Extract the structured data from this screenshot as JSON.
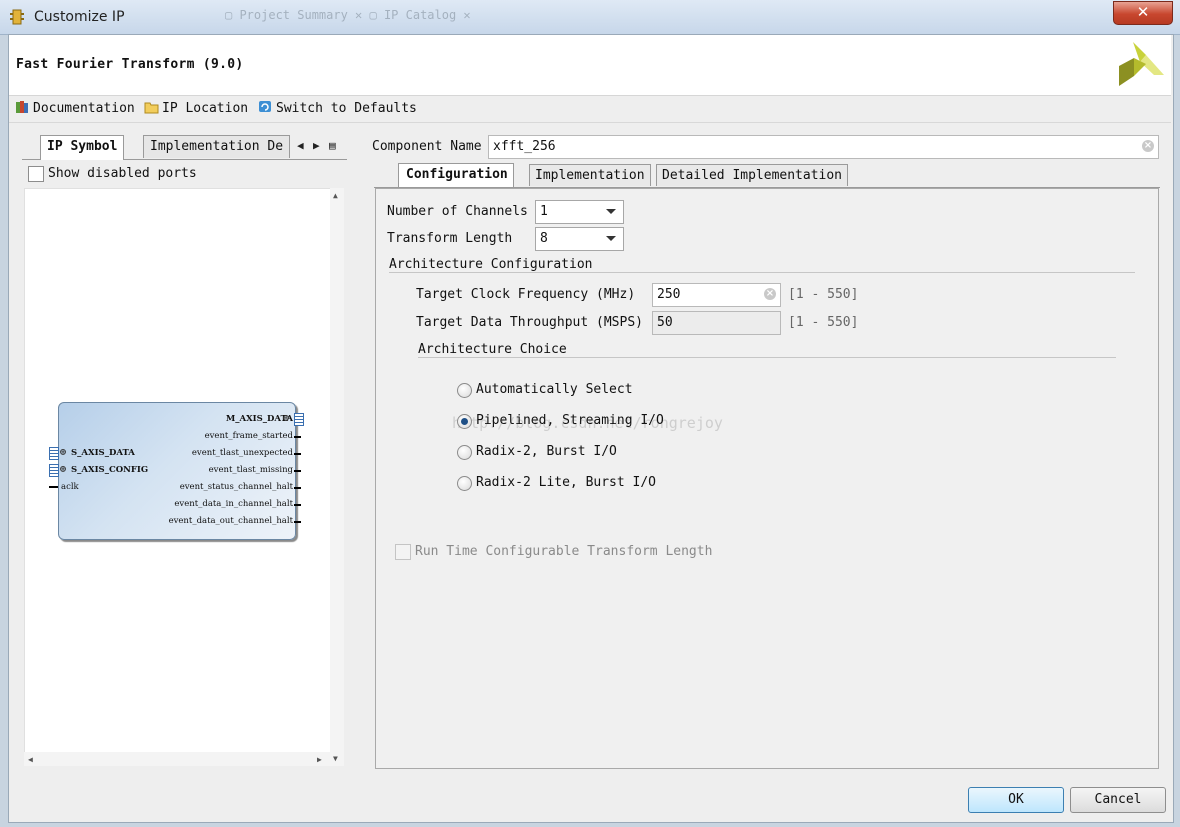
{
  "window": {
    "title": "Customize IP",
    "close_glyph": "✕",
    "background_tabs": "▢  Project Summary  ✕  ▢ IP Catalog  ✕"
  },
  "header": {
    "ip_title": "Fast Fourier Transform (9.0)",
    "logo": "xilinx-logo-icon"
  },
  "toolbar": {
    "documentation": "Documentation",
    "ip_location": "IP Location",
    "switch_defaults": "Switch to Defaults"
  },
  "left_panel": {
    "tabs": [
      "IP Symbol",
      "Implementation De"
    ],
    "show_disabled_ports": "Show disabled ports",
    "symbol": {
      "right_ports": [
        "M_AXIS_DATA",
        "event_frame_started",
        "event_tlast_unexpected",
        "event_tlast_missing",
        "event_status_channel_halt",
        "event_data_in_channel_halt",
        "event_data_out_channel_halt"
      ],
      "left_ports": [
        "S_AXIS_DATA",
        "S_AXIS_CONFIG",
        "aclk"
      ]
    }
  },
  "right_panel": {
    "component_name_label": "Component Name",
    "component_name_value": "xfft_256",
    "tabs": [
      "Configuration",
      "Implementation",
      "Detailed Implementation"
    ],
    "config": {
      "channels_label": "Number of Channels",
      "channels_value": "1",
      "length_label": "Transform Length",
      "length_value": "8",
      "arch_config_label": "Architecture Configuration",
      "clock_label": "Target Clock Frequency (MHz)",
      "clock_value": "250",
      "clock_range": "[1 - 550]",
      "throughput_label": "Target Data Throughput (MSPS)",
      "throughput_value": "50",
      "throughput_range": "[1 - 550]",
      "arch_choice_label": "Architecture Choice",
      "arch_options": [
        "Automatically Select",
        "Pipelined, Streaming I/O",
        "Radix-2, Burst I/O",
        "Radix-2 Lite, Burst I/O"
      ],
      "arch_selected": "Pipelined, Streaming I/O",
      "runtime_label": "Run Time Configurable Transform Length",
      "watermark": "http://blog.csdn.net/rongrejoy"
    }
  },
  "buttons": {
    "ok": "OK",
    "cancel": "Cancel"
  }
}
